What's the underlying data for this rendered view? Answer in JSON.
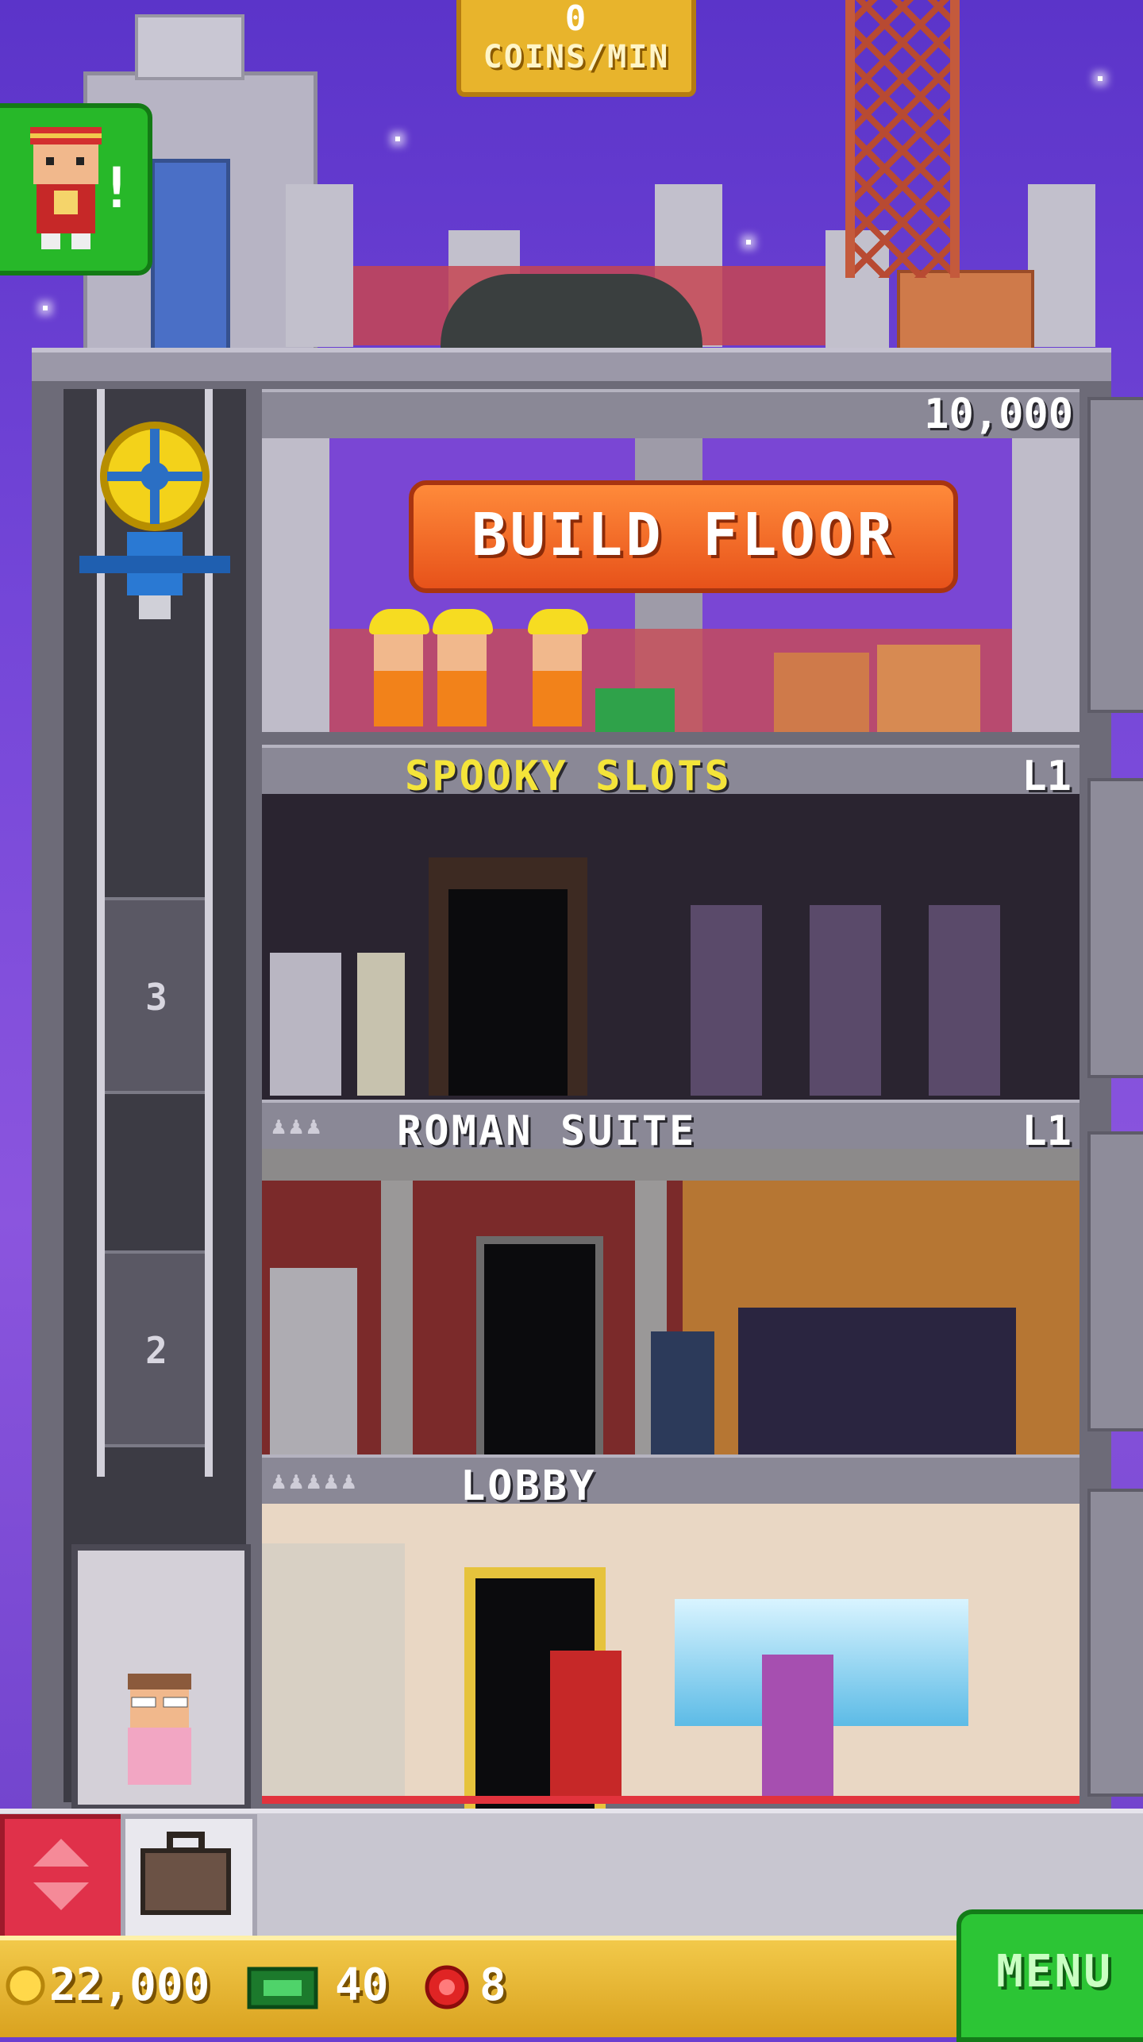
{
  "hud": {
    "coins_per_min_value": "0",
    "coins_per_min_label": "COINS/MIN"
  },
  "build": {
    "button_label": "BUILD FLOOR",
    "cost": "10,000"
  },
  "floors": [
    {
      "name": "SPOOKY SLOTS",
      "level": "L1"
    },
    {
      "name": "ROMAN SUITE",
      "level": "L1"
    },
    {
      "name": "LOBBY",
      "level": ""
    }
  ],
  "elevator": {
    "floor_numbers": [
      "3",
      "2"
    ]
  },
  "status": {
    "coins": "22,000",
    "bux": "40",
    "tickets": "8"
  },
  "menu_label": "MENU",
  "colors": {
    "sky": "#6a3fd0",
    "build_button": "#ef6a24",
    "spooky_title": "#f4e43a",
    "menu_green": "#2cc535",
    "coin_bar": "#e8b42c"
  },
  "icons": [
    "bellhop-notification-icon",
    "elevator-motor-icon",
    "elevator-up-down-icon",
    "briefcase-icon",
    "coin-icon",
    "bux-icon",
    "ticket-icon"
  ]
}
